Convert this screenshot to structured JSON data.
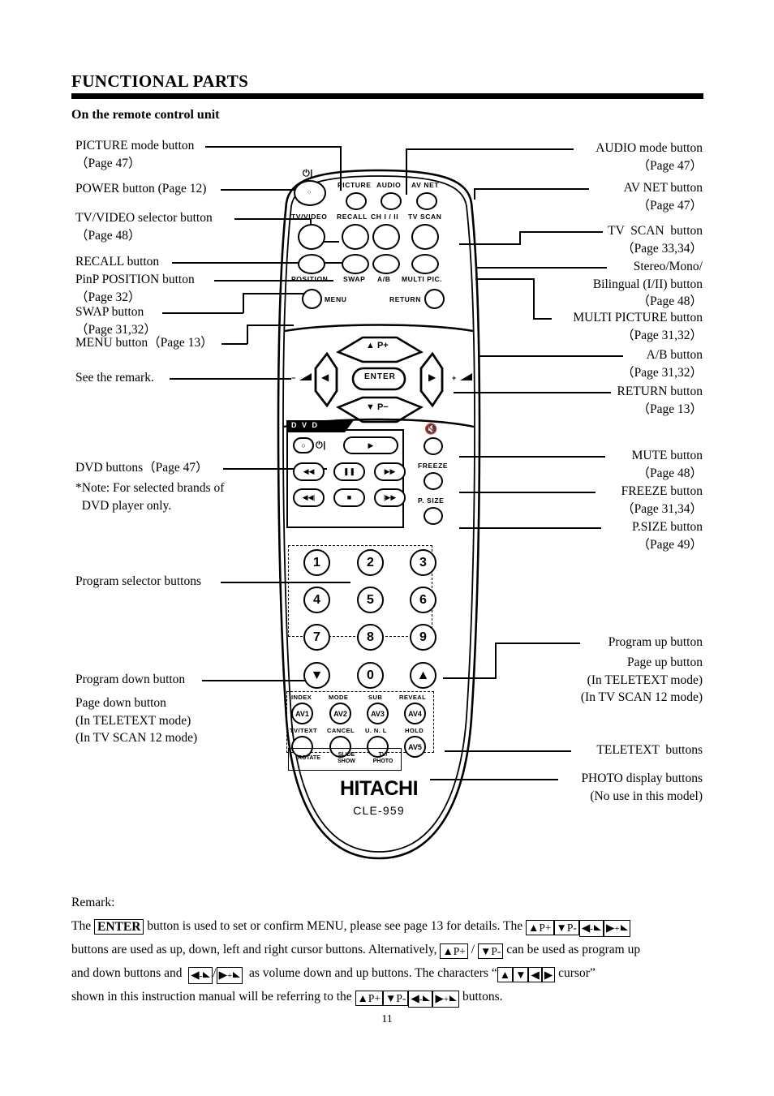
{
  "header": {
    "title": "FUNCTIONAL PARTS",
    "subtitle": "On the remote control unit"
  },
  "callouts_left": [
    {
      "id": "picture-mode",
      "lines": [
        "PICTURE mode button",
        "（Page 47）"
      ]
    },
    {
      "id": "power",
      "lines": [
        "POWER button (Page 12)"
      ]
    },
    {
      "id": "tv-video",
      "lines": [
        "TV/VIDEO selector button",
        "（Page 48）"
      ]
    },
    {
      "id": "recall",
      "lines": [
        "RECALL button"
      ]
    },
    {
      "id": "pinp-position",
      "lines": [
        "PinP POSITION button",
        "（Page 32）"
      ]
    },
    {
      "id": "swap",
      "lines": [
        "SWAP button",
        "（Page 31,32）"
      ]
    },
    {
      "id": "menu",
      "lines": [
        "MENU button（Page 13）"
      ]
    },
    {
      "id": "see-remark",
      "lines": [
        "See the remark."
      ]
    },
    {
      "id": "dvd-buttons",
      "lines": [
        "DVD buttons（Page 47）"
      ]
    },
    {
      "id": "dvd-note",
      "lines": [
        "*Note: For selected brands of",
        "  DVD player only."
      ]
    },
    {
      "id": "program-selector",
      "lines": [
        "Program selector buttons"
      ]
    },
    {
      "id": "program-down",
      "lines": [
        "Program down button"
      ]
    },
    {
      "id": "page-down",
      "lines": [
        "Page down button",
        "(In TELETEXT mode)",
        "(In TV SCAN 12 mode)"
      ]
    }
  ],
  "callouts_right": [
    {
      "id": "audio-mode",
      "lines": [
        "AUDIO mode button",
        "（Page 47）"
      ]
    },
    {
      "id": "av-net",
      "lines": [
        "AV NET button",
        "（Page 47）"
      ]
    },
    {
      "id": "tv-scan",
      "lines": [
        "TV  SCAN  button",
        "（Page 33,34）"
      ]
    },
    {
      "id": "stereo-mono",
      "lines": [
        "Stereo/Mono/",
        "Bilingual (I/II) button",
        "（Page 48）"
      ]
    },
    {
      "id": "multi-picture",
      "lines": [
        "MULTI PICTURE button",
        "（Page 31,32）"
      ]
    },
    {
      "id": "ab",
      "lines": [
        "A/B button",
        "（Page 31,32）"
      ]
    },
    {
      "id": "return",
      "lines": [
        "RETURN button",
        "（Page 13）"
      ]
    },
    {
      "id": "mute",
      "lines": [
        "MUTE button",
        "（Page 48）"
      ]
    },
    {
      "id": "freeze",
      "lines": [
        "FREEZE button",
        "（Page 31,34）"
      ]
    },
    {
      "id": "psize",
      "lines": [
        "P.SIZE button",
        "（Page 49）"
      ]
    },
    {
      "id": "program-up",
      "lines": [
        "Program up button"
      ]
    },
    {
      "id": "page-up",
      "lines": [
        "Page up button",
        "(In TELETEXT mode)",
        "(In TV SCAN 12 mode)"
      ]
    },
    {
      "id": "teletext",
      "lines": [
        "TELETEXT  buttons"
      ]
    },
    {
      "id": "photo-display",
      "lines": [
        "PHOTO display buttons",
        "(No use in this model)"
      ]
    }
  ],
  "remote": {
    "brand": "HITACHI",
    "model": "CLE-959",
    "dvd_tab_label": "D V D",
    "top_captions": {
      "picture": "PICTURE",
      "audio": "AUDIO",
      "av_net": "AV NET",
      "tv_video": "TV/VIDEO",
      "recall": "RECALL",
      "ch_i_ii": "CH I / II",
      "tv_scan": "TV SCAN",
      "position": "POSITION",
      "swap": "SWAP",
      "ab": "A/B",
      "multi_pic": "MULTI PIC.",
      "menu": "MENU",
      "return": "RETURN",
      "freeze": "FREEZE",
      "psize": "P. SIZE"
    },
    "nav": {
      "enter": "ENTER",
      "up": "▲ P+",
      "down": "▼ P−",
      "left": "◀",
      "right": "▶",
      "vol_down": "−",
      "vol_up": "+"
    },
    "keypad": [
      "1",
      "2",
      "3",
      "4",
      "5",
      "6",
      "7",
      "8",
      "9",
      "0"
    ],
    "teletext": {
      "top_row_captions": [
        "INDEX",
        "MODE",
        "SUB",
        "REVEAL"
      ],
      "top_row_buttons": [
        "AV1",
        "AV2",
        "AV3",
        "AV4"
      ],
      "bottom_row_captions": [
        "TV/TEXT",
        "CANCEL",
        "U. N. L",
        "HOLD"
      ],
      "bottom_row_buttons": [
        "",
        "",
        "",
        "AV5"
      ],
      "photo_buttons": [
        "ROTATE",
        "SLIDE\nSHOW",
        "TV/\nPHOTO"
      ]
    }
  },
  "remark": {
    "heading": "Remark:",
    "enter_key": "ENTER",
    "line1_a": "The ",
    "line1_b": " button is used to set or confirm MENU, please see page 13 for details. The ",
    "line2_a": "buttons are used as up, down, left and right cursor buttons. Alternatively, ",
    "line2_mid": " / ",
    "line2_b": " can be used as program up",
    "line3_a": "and down buttons and",
    "line3_b": "as volume down and up buttons. The characters “",
    "line3_c": "cursor”",
    "line4_a": "shown in this instruction manual will be referring to the ",
    "line4_b": " buttons.",
    "keys": {
      "p_up": "▲P+",
      "p_down": "▼P-",
      "vol_down": "◀",
      "vol_up": "▶",
      "vol_down_sign": "-",
      "vol_up_sign": "+",
      "up": "▲",
      "down": "▼",
      "left": "◀",
      "right": "▶"
    }
  },
  "page_number": "11",
  "colors": {
    "ink": "#000000",
    "paper": "#ffffff"
  }
}
